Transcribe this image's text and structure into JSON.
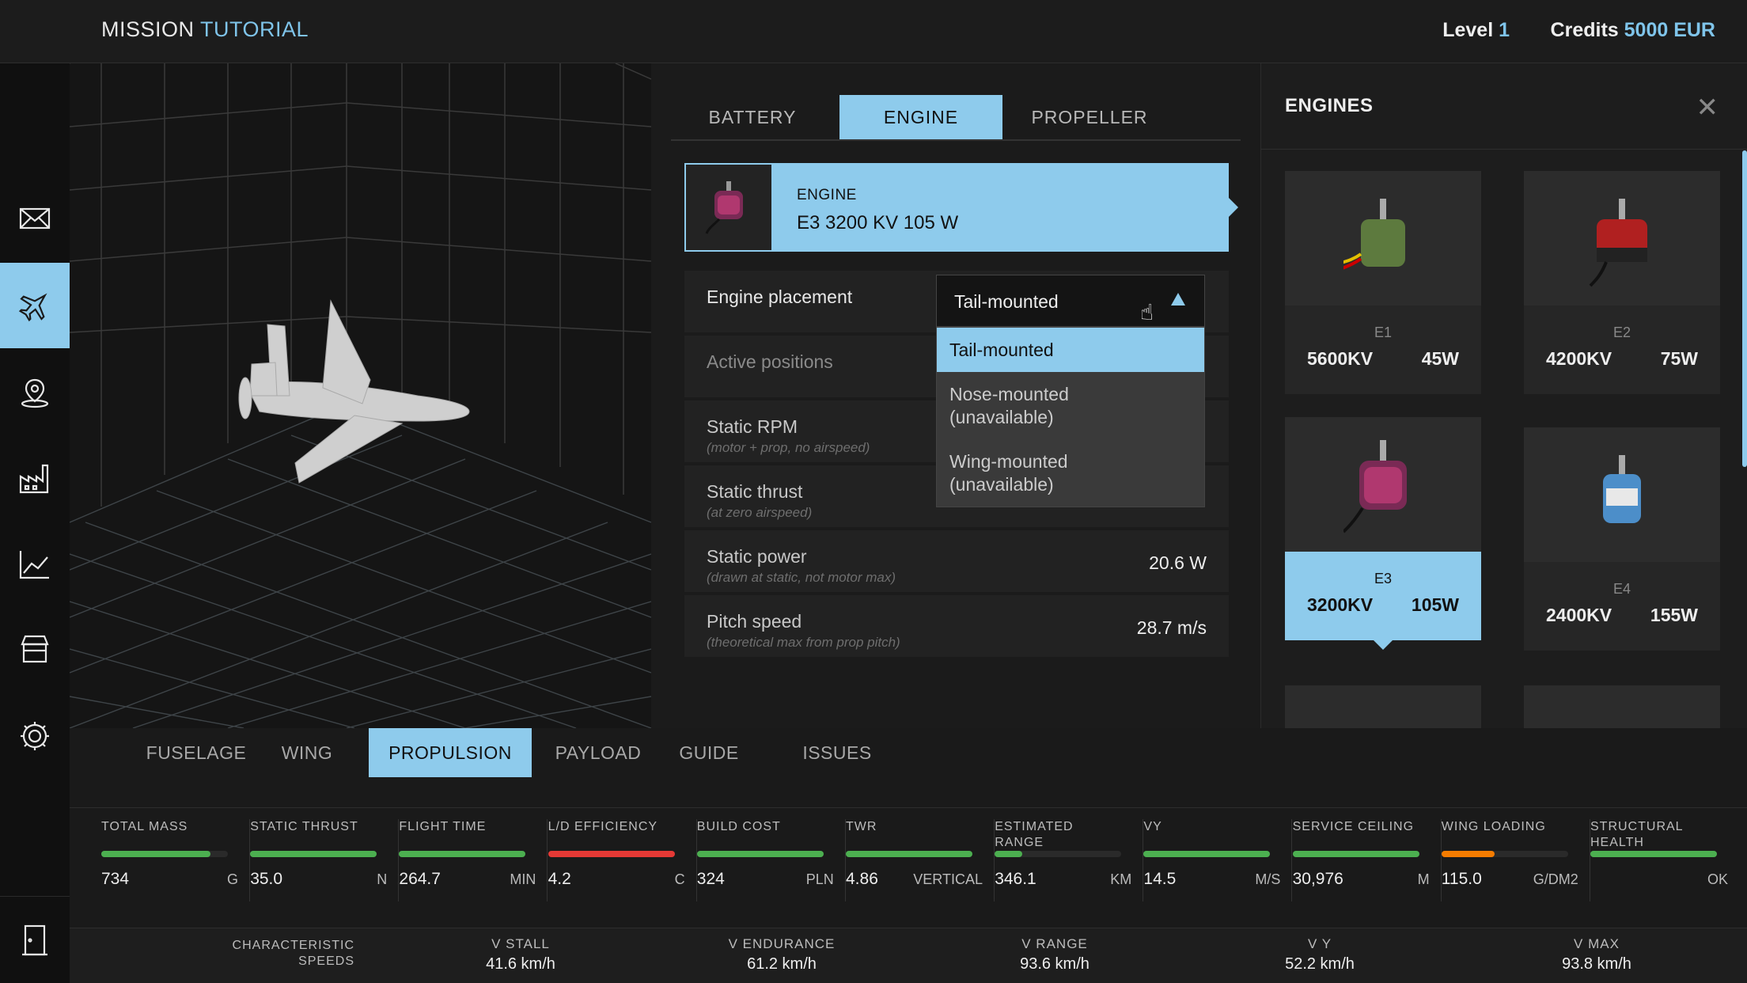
{
  "header": {
    "title_main": "MISSION ",
    "title_accent": "TUTORIAL",
    "level_label": "Level ",
    "level_value": "1",
    "credits_label": "Credits ",
    "credits_value": "5000 EUR"
  },
  "sidebar": {
    "items": [
      "mail",
      "aircraft",
      "location",
      "factory",
      "analytics",
      "shop",
      "settings"
    ],
    "active": "aircraft"
  },
  "propulsion": {
    "tabs": [
      "BATTERY",
      "ENGINE",
      "PROPELLER"
    ],
    "active_tab": "ENGINE",
    "engine_card": {
      "label": "ENGINE",
      "value": "E3 3200 KV 105 W"
    },
    "rows": [
      {
        "name": "Engine placement"
      },
      {
        "name": "Active positions"
      },
      {
        "name": "Static RPM",
        "sub": "(motor + prop, no airspeed)"
      },
      {
        "name": "Static thrust",
        "sub": "(at zero airspeed)"
      },
      {
        "name": "Static power",
        "sub": "(drawn at static, not motor max)",
        "value": "20.6 W"
      },
      {
        "name": "Pitch speed",
        "sub": "(theoretical max from prop pitch)",
        "value": "28.7 m/s"
      }
    ],
    "dropdown": {
      "selected": "Tail-mounted",
      "options": [
        "Tail-mounted",
        "Nose-mounted\n(unavailable)",
        "Wing-mounted\n(unavailable)"
      ]
    }
  },
  "engines_panel": {
    "title": "ENGINES",
    "tiles": [
      {
        "code": "E1",
        "kv": "5600KV",
        "w": "45W",
        "color": "#5d7a3e"
      },
      {
        "code": "E2",
        "kv": "4200KV",
        "w": "75W",
        "color": "#b02020"
      },
      {
        "code": "E3",
        "kv": "3200KV",
        "w": "105W",
        "color": "#7a2a55",
        "active": true
      },
      {
        "code": "E4",
        "kv": "2400KV",
        "w": "155W",
        "color": "#4c8ec9"
      }
    ]
  },
  "bottom_tabs": [
    "FUSELAGE",
    "WING",
    "PROPULSION",
    "PAYLOAD",
    "GUIDE",
    "ISSUES"
  ],
  "bottom_active": "PROPULSION",
  "metrics": [
    {
      "label": "TOTAL MASS",
      "value": "734",
      "unit": "G",
      "fill": 0.86,
      "color": "#4caf50"
    },
    {
      "label": "STATIC THRUST",
      "value": "35.0",
      "unit": "N",
      "fill": 1.0,
      "color": "#4caf50"
    },
    {
      "label": "FLIGHT TIME",
      "value": "264.7",
      "unit": "MIN",
      "fill": 1.0,
      "color": "#4caf50"
    },
    {
      "label": "L/D EFFICIENCY",
      "value": "4.2",
      "unit": "C",
      "fill": 1.0,
      "color": "#e53935"
    },
    {
      "label": "BUILD COST",
      "value": "324",
      "unit": "PLN",
      "fill": 1.0,
      "color": "#4caf50"
    },
    {
      "label": "TWR",
      "value": "4.86",
      "unit": "VERTICAL",
      "fill": 1.0,
      "color": "#4caf50"
    },
    {
      "label": "ESTIMATED\nRANGE",
      "value": "346.1",
      "unit": "KM",
      "fill": 0.22,
      "color": "#4caf50"
    },
    {
      "label": "VY",
      "value": "14.5",
      "unit": "M/S",
      "fill": 1.0,
      "color": "#4caf50"
    },
    {
      "label": "SERVICE CEILING",
      "value": "30,976",
      "unit": "M",
      "fill": 1.0,
      "color": "#4caf50"
    },
    {
      "label": "WING LOADING",
      "value": "115.0",
      "unit": "G/DM2",
      "fill": 0.42,
      "color": "#f57c00"
    },
    {
      "label": "STRUCTURAL\nHEALTH",
      "value": "",
      "unit": "OK",
      "fill": 1.0,
      "color": "#4caf50"
    }
  ],
  "speeds": {
    "caption": "CHARACTERISTIC\nSPEEDS",
    "items": [
      {
        "label": "V STALL",
        "value": "41.6 km/h"
      },
      {
        "label": "V ENDURANCE",
        "value": "61.2 km/h"
      },
      {
        "label": "V RANGE",
        "value": "93.6 km/h"
      },
      {
        "label": "V Y",
        "value": "52.2 km/h"
      },
      {
        "label": "V MAX",
        "value": "93.8 km/h"
      }
    ]
  }
}
